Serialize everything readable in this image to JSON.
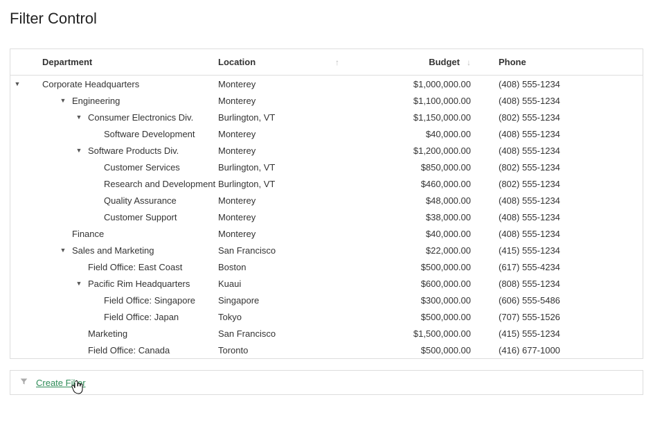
{
  "title": "Filter Control",
  "columns": {
    "department": "Department",
    "location": "Location",
    "budget": "Budget",
    "phone": "Phone"
  },
  "sort": {
    "location": "asc",
    "budget": "desc"
  },
  "rows": [
    {
      "level": 0,
      "expandable": true,
      "department": "Corporate Headquarters",
      "location": "Monterey",
      "budget": "$1,000,000.00",
      "phone": "(408) 555-1234"
    },
    {
      "level": 1,
      "expandable": true,
      "department": "Engineering",
      "location": "Monterey",
      "budget": "$1,100,000.00",
      "phone": "(408) 555-1234"
    },
    {
      "level": 2,
      "expandable": true,
      "department": "Consumer Electronics Div.",
      "location": "Burlington, VT",
      "budget": "$1,150,000.00",
      "phone": "(802) 555-1234"
    },
    {
      "level": 3,
      "expandable": false,
      "department": "Software Development",
      "location": "Monterey",
      "budget": "$40,000.00",
      "phone": "(408) 555-1234"
    },
    {
      "level": 2,
      "expandable": true,
      "department": "Software Products Div.",
      "location": "Monterey",
      "budget": "$1,200,000.00",
      "phone": "(408) 555-1234"
    },
    {
      "level": 3,
      "expandable": false,
      "department": "Customer Services",
      "location": "Burlington, VT",
      "budget": "$850,000.00",
      "phone": "(802) 555-1234"
    },
    {
      "level": 3,
      "expandable": false,
      "department": "Research and Development",
      "location": "Burlington, VT",
      "budget": "$460,000.00",
      "phone": "(802) 555-1234"
    },
    {
      "level": 3,
      "expandable": false,
      "department": "Quality Assurance",
      "location": "Monterey",
      "budget": "$48,000.00",
      "phone": "(408) 555-1234"
    },
    {
      "level": 3,
      "expandable": false,
      "department": "Customer Support",
      "location": "Monterey",
      "budget": "$38,000.00",
      "phone": "(408) 555-1234"
    },
    {
      "level": 1,
      "expandable": false,
      "department": "Finance",
      "location": "Monterey",
      "budget": "$40,000.00",
      "phone": "(408) 555-1234"
    },
    {
      "level": 1,
      "expandable": true,
      "department": "Sales and Marketing",
      "location": "San Francisco",
      "budget": "$22,000.00",
      "phone": "(415) 555-1234"
    },
    {
      "level": 2,
      "expandable": false,
      "department": "Field Office: East Coast",
      "location": "Boston",
      "budget": "$500,000.00",
      "phone": "(617) 555-4234"
    },
    {
      "level": 2,
      "expandable": true,
      "department": "Pacific Rim Headquarters",
      "location": "Kuaui",
      "budget": "$600,000.00",
      "phone": "(808) 555-1234"
    },
    {
      "level": 3,
      "expandable": false,
      "department": "Field Office: Singapore",
      "location": "Singapore",
      "budget": "$300,000.00",
      "phone": "(606) 555-5486"
    },
    {
      "level": 3,
      "expandable": false,
      "department": "Field Office: Japan",
      "location": "Tokyo",
      "budget": "$500,000.00",
      "phone": "(707) 555-1526"
    },
    {
      "level": 2,
      "expandable": false,
      "department": "Marketing",
      "location": "San Francisco",
      "budget": "$1,500,000.00",
      "phone": "(415) 555-1234"
    },
    {
      "level": 2,
      "expandable": false,
      "department": "Field Office: Canada",
      "location": "Toronto",
      "budget": "$500,000.00",
      "phone": "(416) 677-1000"
    }
  ],
  "filter_bar": {
    "create_label": "Create Filter"
  }
}
